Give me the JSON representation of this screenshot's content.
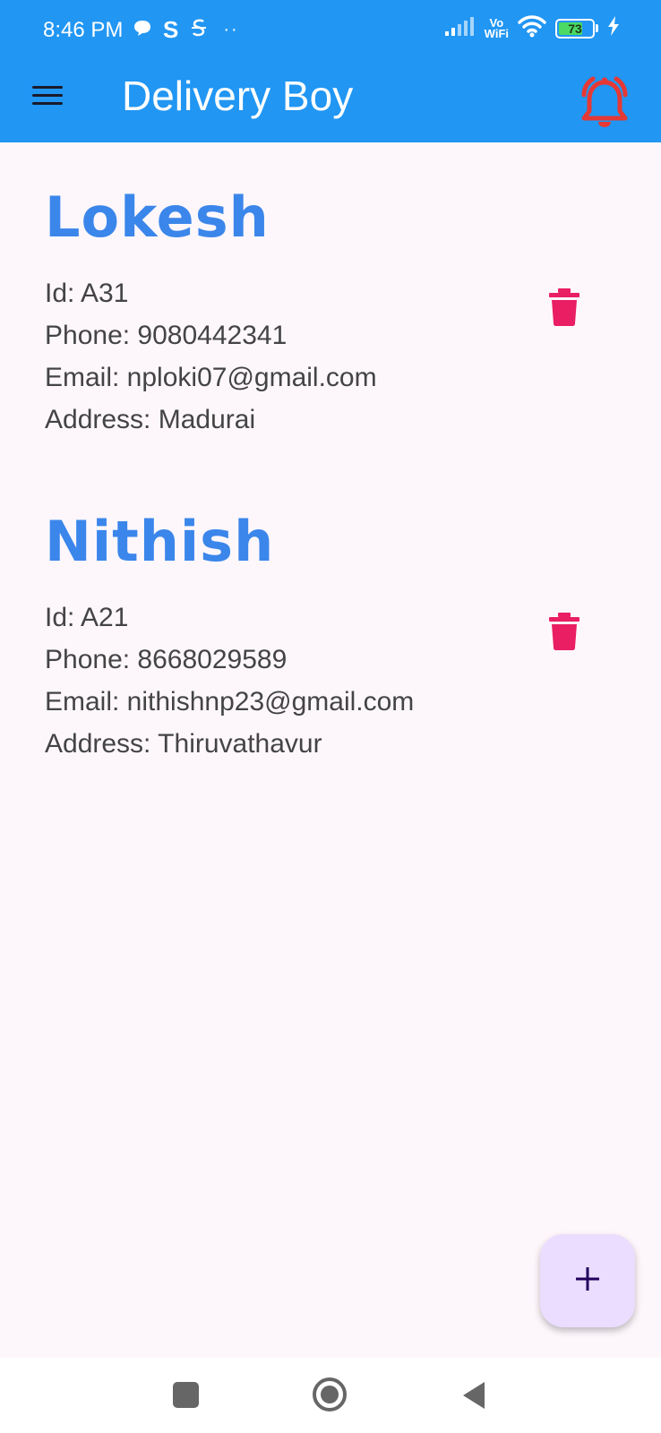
{
  "status_bar": {
    "time": "8:46 PM",
    "icons": [
      "chat-bubble-icon",
      "s-app-icon",
      "s-outline-icon",
      "more-dots-icon",
      "signal-icon",
      "vowifi-icon",
      "wifi-icon",
      "battery-icon",
      "charging-bolt-icon"
    ],
    "vowifi_top": "Vo",
    "vowifi_bottom": "WiFi",
    "battery": "73",
    "battery_level": 0.73
  },
  "app_bar": {
    "title": "Delivery Boy",
    "menu_icon": "hamburger-menu-icon",
    "alert_icon": "bell-alert-icon",
    "alert_color": "#e53935",
    "background": "#2196f3"
  },
  "delivery_boys": [
    {
      "name": "Lokesh",
      "id": "Id: A31",
      "phone": "Phone: 9080442341",
      "email": "Email: nploki07@gmail.com",
      "address": "Address: Madurai"
    },
    {
      "name": "Nithish",
      "id": "Id: A21",
      "phone": "Phone: 8668029589",
      "email": "Email: nithishnp23@gmail.com",
      "address": "Address: Thiruvathavur"
    }
  ],
  "colors": {
    "name": "#3b86ea",
    "delete": "#e91e63",
    "fab_bg": "#eaddff",
    "fab_icon": "#21005d"
  },
  "fab": {
    "icon": "plus-icon"
  },
  "nav_bar": {
    "icons": [
      "recents-square-icon",
      "home-circle-icon",
      "back-triangle-icon"
    ]
  }
}
